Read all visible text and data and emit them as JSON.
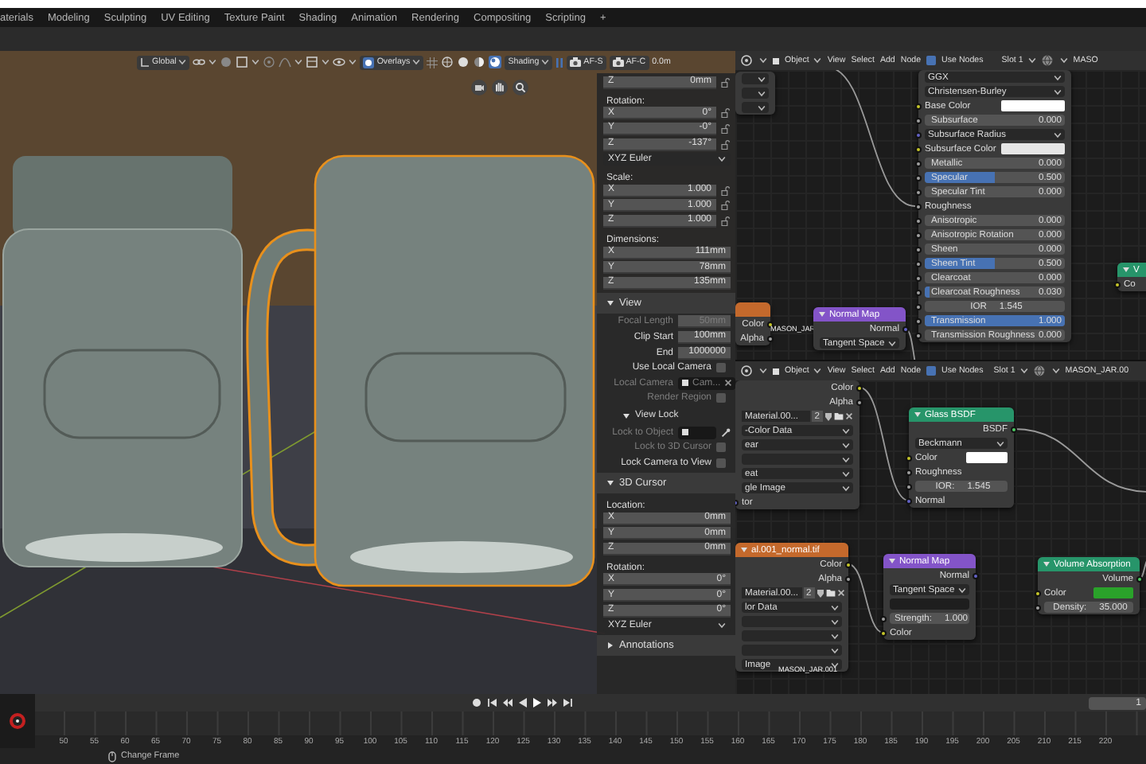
{
  "top_bar": {
    "workspace_tabs": [
      {
        "label": "aterials"
      },
      {
        "label": "Modeling"
      },
      {
        "label": "Sculpting"
      },
      {
        "label": "UV Editing"
      },
      {
        "label": "Texture Paint"
      },
      {
        "label": "Shading"
      },
      {
        "label": "Animation"
      },
      {
        "label": "Rendering"
      },
      {
        "label": "Compositing"
      },
      {
        "label": "Scripting"
      }
    ],
    "add_tab": "+"
  },
  "viewport": {
    "header": {
      "orientation": "Global",
      "overlays": "Overlays",
      "shading_modes": [
        {
          "kind": "wireframe",
          "selected": false
        },
        {
          "kind": "solid",
          "selected": false
        },
        {
          "kind": "material",
          "selected": false
        },
        {
          "kind": "rendered",
          "selected": true
        }
      ],
      "shading": "Shading",
      "camera_buttons": [
        "AF-S",
        "AF-C"
      ],
      "distance": "0.0m"
    }
  },
  "n_panel": {
    "rows": [
      {
        "kind": "axis",
        "label": "Z",
        "value": "0mm",
        "locked": false
      },
      {
        "kind": "heading",
        "text": "Rotation:"
      },
      {
        "kind": "axis",
        "label": "X",
        "value": "0°",
        "locked": false
      },
      {
        "kind": "axis",
        "label": "Y",
        "value": "-0°",
        "locked": false
      },
      {
        "kind": "axis",
        "label": "Z",
        "value": "-137°",
        "locked": false
      },
      {
        "kind": "dropdown",
        "text": "XYZ Euler"
      },
      {
        "kind": "heading",
        "text": "Scale:"
      },
      {
        "kind": "axis",
        "label": "X",
        "value": "1.000",
        "locked": false
      },
      {
        "kind": "axis",
        "label": "Y",
        "value": "1.000",
        "locked": false
      },
      {
        "kind": "axis",
        "label": "Z",
        "value": "1.000",
        "locked": false
      },
      {
        "kind": "heading",
        "text": "Dimensions:"
      },
      {
        "kind": "axis",
        "label": "X",
        "value": "111mm"
      },
      {
        "kind": "axis",
        "label": "Y",
        "value": "78mm"
      },
      {
        "kind": "axis",
        "label": "Z",
        "value": "135mm"
      },
      {
        "kind": "section",
        "text": "View",
        "expanded": true
      },
      {
        "kind": "prop",
        "label": "Focal Length",
        "value": "50mm",
        "disabled": true
      },
      {
        "kind": "prop",
        "label": "Clip Start",
        "value": "100mm",
        "disabled": false
      },
      {
        "kind": "prop",
        "label": "End",
        "value": "1000000",
        "disabled": false
      },
      {
        "kind": "checkbox",
        "label": "Use Local Camera",
        "checked": false,
        "disabled": false
      },
      {
        "kind": "object_field",
        "label": "Local Camera",
        "value": "Cam...",
        "disabled": true
      },
      {
        "kind": "checkbox",
        "label": "Render Region",
        "checked": false,
        "disabled": true
      },
      {
        "kind": "subsection",
        "text": "View Lock",
        "expanded": true
      },
      {
        "kind": "object_field",
        "label": "Lock to Object",
        "disabled": true
      },
      {
        "kind": "checkbox",
        "label": "Lock to 3D Cursor",
        "checked": false,
        "disabled": true
      },
      {
        "kind": "checkbox",
        "label": "Lock Camera to View",
        "checked": false,
        "disabled": false
      },
      {
        "kind": "section",
        "text": "3D Cursor",
        "expanded": true
      },
      {
        "kind": "heading",
        "text": "Location:"
      },
      {
        "kind": "axis",
        "label": "X",
        "value": "0mm"
      },
      {
        "kind": "axis",
        "label": "Y",
        "value": "0mm"
      },
      {
        "kind": "axis",
        "label": "Z",
        "value": "0mm"
      },
      {
        "kind": "heading",
        "text": "Rotation:"
      },
      {
        "kind": "axis",
        "label": "X",
        "value": "0°"
      },
      {
        "kind": "axis",
        "label": "Y",
        "value": "0°"
      },
      {
        "kind": "axis",
        "label": "Z",
        "value": "0°"
      },
      {
        "kind": "dropdown",
        "text": "XYZ Euler"
      },
      {
        "kind": "section",
        "text": "Annotations",
        "expanded": false
      }
    ]
  },
  "node_editors": [
    {
      "header": {
        "object_mode": "Object",
        "menus": [
          "View",
          "Select",
          "Add",
          "Node"
        ],
        "use_nodes": {
          "label": "Use Nodes",
          "checked": true
        },
        "slot": "Slot 1",
        "material": "MASO"
      },
      "nodes": [
        {
          "kind": "node",
          "rows": [
            {
              "kind": "dropdown"
            },
            {
              "kind": "dropdown"
            },
            {
              "kind": "dropdown"
            }
          ]
        },
        {
          "kind": "node",
          "color": "#c4692c",
          "rows": [
            {
              "kind": "output",
              "label": "Color",
              "socket": {
                "kind": "color"
              }
            },
            {
              "kind": "output",
              "label": "Alpha",
              "socket": {
                "kind": "float"
              }
            }
          ]
        },
        {
          "kind": "label",
          "text": "MASON_JAR"
        },
        {
          "kind": "node",
          "title": "Normal Map",
          "color": "#8354c8",
          "rows": [
            {
              "kind": "output",
              "label": "Normal",
              "socket": {
                "kind": "vector"
              }
            },
            {
              "kind": "dropdown",
              "text": "Tangent Space"
            }
          ]
        },
        {
          "kind": "node",
          "rows": [
            {
              "kind": "dropdown",
              "text": "GGX"
            },
            {
              "kind": "dropdown",
              "text": "Christensen-Burley"
            },
            {
              "kind": "color",
              "label": "Base Color",
              "color": "#ffffff",
              "socket": {
                "kind": "color"
              }
            },
            {
              "kind": "slider",
              "label": "Subsurface",
              "value": "0.000",
              "level": 0,
              "socket": {
                "kind": "float"
              }
            },
            {
              "kind": "dropdown",
              "text": "Subsurface Radius",
              "socket": {
                "kind": "vector"
              }
            },
            {
              "kind": "color",
              "label": "Subsurface Color",
              "color": "#e6e6e6",
              "socket": {
                "kind": "color"
              }
            },
            {
              "kind": "slider",
              "label": "Metallic",
              "value": "0.000",
              "level": 0,
              "socket": {
                "kind": "float"
              }
            },
            {
              "kind": "slider",
              "label": "Specular",
              "value": "0.500",
              "level": 0.5,
              "socket": {
                "kind": "float"
              }
            },
            {
              "kind": "slider",
              "label": "Specular Tint",
              "value": "0.000",
              "level": 0,
              "socket": {
                "kind": "float"
              }
            },
            {
              "kind": "input",
              "label": "Roughness",
              "socket": {
                "kind": "float"
              }
            },
            {
              "kind": "slider",
              "label": "Anisotropic",
              "value": "0.000",
              "level": 0,
              "socket": {
                "kind": "float"
              }
            },
            {
              "kind": "slider",
              "label": "Anisotropic Rotation",
              "value": "0.000",
              "level": 0,
              "socket": {
                "kind": "float"
              }
            },
            {
              "kind": "slider",
              "label": "Sheen",
              "value": "0.000",
              "level": 0,
              "socket": {
                "kind": "float"
              }
            },
            {
              "kind": "slider",
              "label": "Sheen Tint",
              "value": "0.500",
              "level": 0.5,
              "socket": {
                "kind": "float"
              }
            },
            {
              "kind": "slider",
              "label": "Clearcoat",
              "value": "0.000",
              "level": 0,
              "socket": {
                "kind": "float"
              }
            },
            {
              "kind": "slider",
              "label": "Clearcoat Roughness",
              "value": "0.030",
              "level": 0.03,
              "socket": {
                "kind": "float"
              }
            },
            {
              "kind": "field",
              "label": "IOR",
              "value": "1.545",
              "socket": {
                "kind": "float"
              }
            },
            {
              "kind": "slider",
              "label": "Transmission",
              "value": "1.000",
              "level": 1,
              "socket": {
                "kind": "float"
              }
            },
            {
              "kind": "slider",
              "label": "Transmission Roughness",
              "value": "0.000",
              "level": 0,
              "socket": {
                "kind": "float"
              }
            }
          ]
        },
        {
          "kind": "node",
          "title": "V",
          "color": "#27956a",
          "rows": [
            {
              "kind": "input",
              "label": "Co",
              "socket": {
                "kind": "color"
              }
            }
          ]
        }
      ]
    },
    {
      "header": {
        "object_mode": "Object",
        "menus": [
          "View",
          "Select",
          "Add",
          "Node"
        ],
        "use_nodes": {
          "label": "Use Nodes",
          "checked": true
        },
        "slot": "Slot 1",
        "material": "MASON_JAR.00"
      },
      "nodes": [
        {
          "kind": "node",
          "rows": [
            {
              "kind": "output",
              "label": "Color",
              "socket": {
                "kind": "color"
              }
            },
            {
              "kind": "output",
              "label": "Alpha",
              "socket": {
                "kind": "float"
              }
            },
            {
              "kind": "image",
              "text": "Material.00...",
              "users": "2"
            },
            {
              "kind": "dropdown",
              "text": "-Color Data"
            },
            {
              "kind": "dropdown",
              "text": "ear"
            },
            {
              "kind": "dropdown"
            },
            {
              "kind": "dropdown",
              "text": "eat"
            },
            {
              "kind": "dropdown",
              "text": "gle Image"
            },
            {
              "kind": "input",
              "label": "tor",
              "socket": {
                "kind": "vector"
              }
            }
          ]
        },
        {
          "kind": "node",
          "title": "al.001_normal.tif",
          "color": "#c4692c",
          "rows": [
            {
              "kind": "output",
              "label": "Color",
              "socket": {
                "kind": "color"
              }
            },
            {
              "kind": "output",
              "label": "Alpha",
              "socket": {
                "kind": "float"
              }
            },
            {
              "kind": "image",
              "text": "Material.00...",
              "users": "2"
            },
            {
              "kind": "dropdown",
              "text": "lor Data"
            },
            {
              "kind": "dropdown"
            },
            {
              "kind": "dropdown"
            },
            {
              "kind": "dropdown"
            },
            {
              "kind": "dropdown",
              "text": "Image"
            }
          ]
        },
        {
          "kind": "label",
          "text": "MASON_JAR.001"
        },
        {
          "kind": "node",
          "title": "Normal Map",
          "color": "#8354c8",
          "rows": [
            {
              "kind": "output",
              "label": "Normal",
              "socket": {
                "kind": "vector"
              }
            },
            {
              "kind": "dropdown",
              "text": "Tangent Space"
            },
            {
              "kind": "uv_field"
            },
            {
              "kind": "field",
              "label": "Strength:",
              "value": "1.000",
              "socket": {
                "kind": "float"
              }
            },
            {
              "kind": "input",
              "label": "Color",
              "socket": {
                "kind": "color"
              }
            }
          ]
        },
        {
          "kind": "node",
          "title": "Glass BSDF",
          "color": "#27956a",
          "rows": [
            {
              "kind": "output",
              "label": "BSDF",
              "socket": {
                "kind": "shader"
              }
            },
            {
              "kind": "dropdown",
              "text": "Beckmann"
            },
            {
              "kind": "color",
              "label": "Color",
              "color": "#ffffff",
              "socket": {
                "kind": "color"
              }
            },
            {
              "kind": "input",
              "label": "Roughness",
              "socket": {
                "kind": "float"
              }
            },
            {
              "kind": "field",
              "label": "IOR:",
              "value": "1.545",
              "socket": {
                "kind": "float"
              }
            },
            {
              "kind": "input",
              "label": "Normal",
              "socket": {
                "kind": "vector"
              }
            }
          ]
        },
        {
          "kind": "node",
          "title": "Volume Absorption",
          "color": "#27956a",
          "rows": [
            {
              "kind": "output",
              "label": "Volume",
              "socket": {
                "kind": "shader"
              }
            },
            {
              "kind": "color",
              "label": "Color",
              "color": "#2aa22a",
              "socket": {
                "kind": "color"
              }
            },
            {
              "kind": "field",
              "label": "Density:",
              "value": "35.000",
              "socket": {
                "kind": "float"
              }
            }
          ]
        }
      ]
    }
  ],
  "timeline": {
    "controls": [
      {
        "kind": "record"
      },
      {
        "kind": "jump_start"
      },
      {
        "kind": "prev_key"
      },
      {
        "kind": "play_reverse"
      },
      {
        "kind": "play"
      },
      {
        "kind": "next_key"
      },
      {
        "kind": "jump_end"
      }
    ],
    "current_frame": "1",
    "frame_labels": [
      "50",
      "55",
      "60",
      "65",
      "70",
      "75",
      "80",
      "85",
      "90",
      "95",
      "100",
      "105",
      "110",
      "115",
      "120",
      "125",
      "130",
      "135",
      "140",
      "145",
      "150",
      "155",
      "160",
      "165",
      "170",
      "175",
      "180",
      "185",
      "190",
      "195",
      "200",
      "205",
      "210",
      "215",
      "220"
    ]
  },
  "status_bar": {
    "mouse_hint": "Change Frame"
  }
}
